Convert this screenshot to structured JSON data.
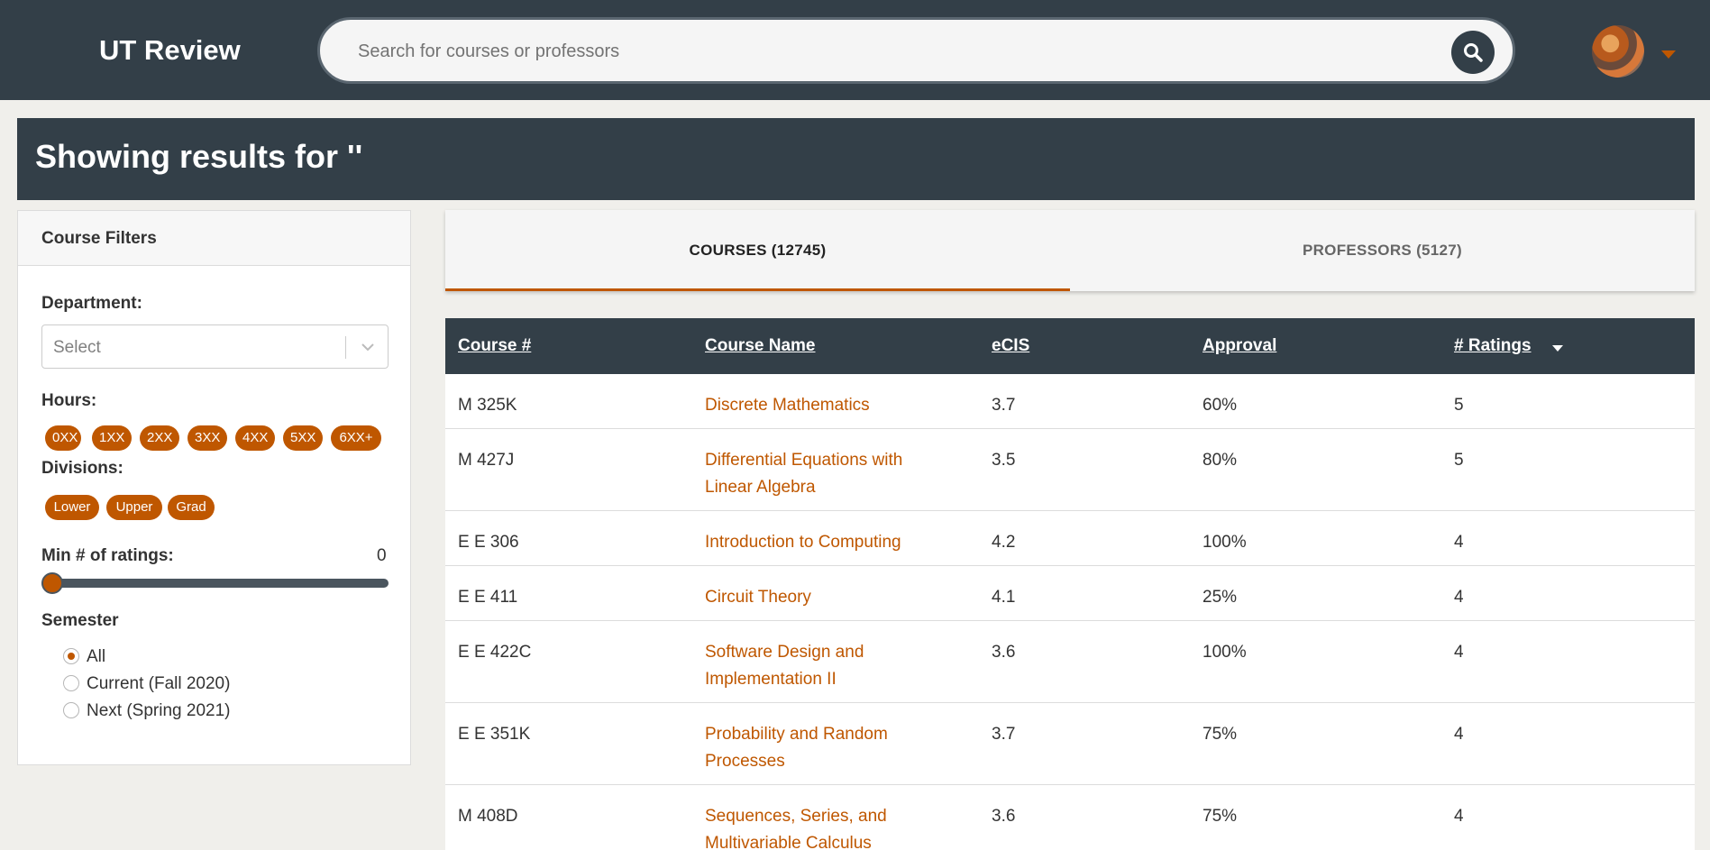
{
  "header": {
    "brand": "UT Review",
    "search_placeholder": "Search for courses or professors"
  },
  "banner": {
    "text": "Showing results for ''"
  },
  "filters": {
    "title": "Course Filters",
    "department_label": "Department:",
    "department_placeholder": "Select",
    "hours_label": "Hours:",
    "hours": [
      "0XX",
      "1XX",
      "2XX",
      "3XX",
      "4XX",
      "5XX",
      "6XX+"
    ],
    "divisions_label": "Divisions:",
    "divisions": [
      "Lower",
      "Upper",
      "Grad"
    ],
    "min_ratings_label": "Min # of ratings:",
    "min_ratings_value": "0",
    "semester_label": "Semester",
    "semesters": [
      {
        "label": "All",
        "checked": true
      },
      {
        "label": "Current (Fall 2020)",
        "checked": false
      },
      {
        "label": "Next (Spring 2021)",
        "checked": false
      }
    ]
  },
  "tabs": [
    {
      "label": "COURSES (12745)",
      "active": true
    },
    {
      "label": "PROFESSORS (5127)",
      "active": false
    }
  ],
  "table": {
    "columns": [
      "Course #",
      "Course Name",
      "eCIS",
      "Approval",
      "# Ratings"
    ],
    "sorted_by": "# Ratings",
    "rows": [
      {
        "course": "M 325K",
        "name": "Discrete Mathematics",
        "ecis": "3.7",
        "approval": "60%",
        "ratings": "5"
      },
      {
        "course": "M 427J",
        "name": "Differential Equations with Linear Algebra",
        "ecis": "3.5",
        "approval": "80%",
        "ratings": "5"
      },
      {
        "course": "E E 306",
        "name": "Introduction to Computing",
        "ecis": "4.2",
        "approval": "100%",
        "ratings": "4"
      },
      {
        "course": "E E 411",
        "name": "Circuit Theory",
        "ecis": "4.1",
        "approval": "25%",
        "ratings": "4"
      },
      {
        "course": "E E 422C",
        "name": "Software Design and Implementation II",
        "ecis": "3.6",
        "approval": "100%",
        "ratings": "4"
      },
      {
        "course": "E E 351K",
        "name": "Probability and Random Processes",
        "ecis": "3.7",
        "approval": "75%",
        "ratings": "4"
      },
      {
        "course": "M 408D",
        "name": "Sequences, Series, and Multivariable Calculus",
        "ecis": "3.6",
        "approval": "75%",
        "ratings": "4"
      }
    ]
  },
  "colors": {
    "nav": "#333f48",
    "accent": "#bf5700",
    "background": "#f0efeb"
  }
}
